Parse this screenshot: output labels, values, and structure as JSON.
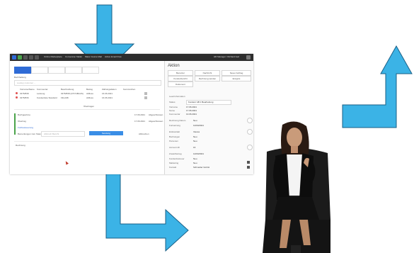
{
  "colors": {
    "arrow": "#3bb3e6",
    "arrow_stroke": "#1a5f86",
    "primary": "#2f6bd6",
    "success": "#4aa34a",
    "topbar": "#2d2d2d"
  },
  "crm": {
    "topbar_items": [
      "Online Marketplace",
      "Conversion Mailer",
      "Mass Invoice Mail",
      "Active Email Flow"
    ],
    "topbar_user": "HR Manager / Richard Geil",
    "tabs": [
      "",
      "",
      "",
      "",
      ""
    ],
    "section_label": "Buchhaltung",
    "search_placeholder": "Lookup customer ...",
    "table_headers": [
      "Vorname/Name",
      "Kommentar",
      "Beschreibung",
      "Betrag",
      "Zahlungsdatum",
      "Kennzeichen"
    ],
    "table_rows": [
      [
        "0375/838",
        "Leistung",
        "0375/838 (47374BAUS)",
        "Abfluss",
        "16.06.2021"
      ],
      [
        "0375/836",
        "Kundenliste Standard",
        "Fibu/AB",
        "Abfluss",
        "16.06.2021"
      ]
    ],
    "table_footer": "Übertragen",
    "list": [
      "Buchgewinne",
      "Übertrag",
      "Fortbesteuerung"
    ],
    "list_dates": [
      "17.06.2021",
      "17.06.2021"
    ],
    "list_status": [
      "Abgeschlossen",
      "Abgeschlossen"
    ],
    "input_label": "Bemerkungen zum Stand",
    "input_placeholder": "Abbruch Bericht",
    "primary_button": "Sendung",
    "secondary_button": "Abbrechen",
    "bottom_label": "Rechnung",
    "right": {
      "title": "Aktion",
      "actions": [
        "Benutzer",
        "Nachricht",
        "Neuer Auftrag",
        "Kundenbericht",
        "Rechnung senden",
        "Ereignis",
        "Dokument"
      ],
      "section": "Lead Information",
      "fields": [
        {
          "label": "Status",
          "value": "Kunden/ AB 1 Bearbeitung"
        },
        {
          "label": "Vorname",
          "value": "17.06.2021"
        },
        {
          "label": "Name",
          "value": "17.06.2021"
        },
        {
          "label": "Kommentar",
          "value": "13.06.2021"
        },
        {
          "label": "Rechnung Datum",
          "value": "Neu"
        },
        {
          "label": "Fortsetzung",
          "value": "12/04/2021"
        },
        {
          "label": "Erstkontakt",
          "value": "Interes"
        },
        {
          "label": "Buchungen",
          "value": "Neu"
        },
        {
          "label": "Personen",
          "value": "Neu"
        },
        {
          "label": "Account-ID",
          "value": "16"
        },
        {
          "label": "Zusatzbetrag",
          "value": "12/04/2021"
        },
        {
          "label": "Kundenbetreuer",
          "value": "Neu"
        },
        {
          "label": "Marketing",
          "value": "Neu"
        },
        {
          "label": "Kontakt",
          "value": "Schneider GmbH"
        }
      ]
    }
  }
}
